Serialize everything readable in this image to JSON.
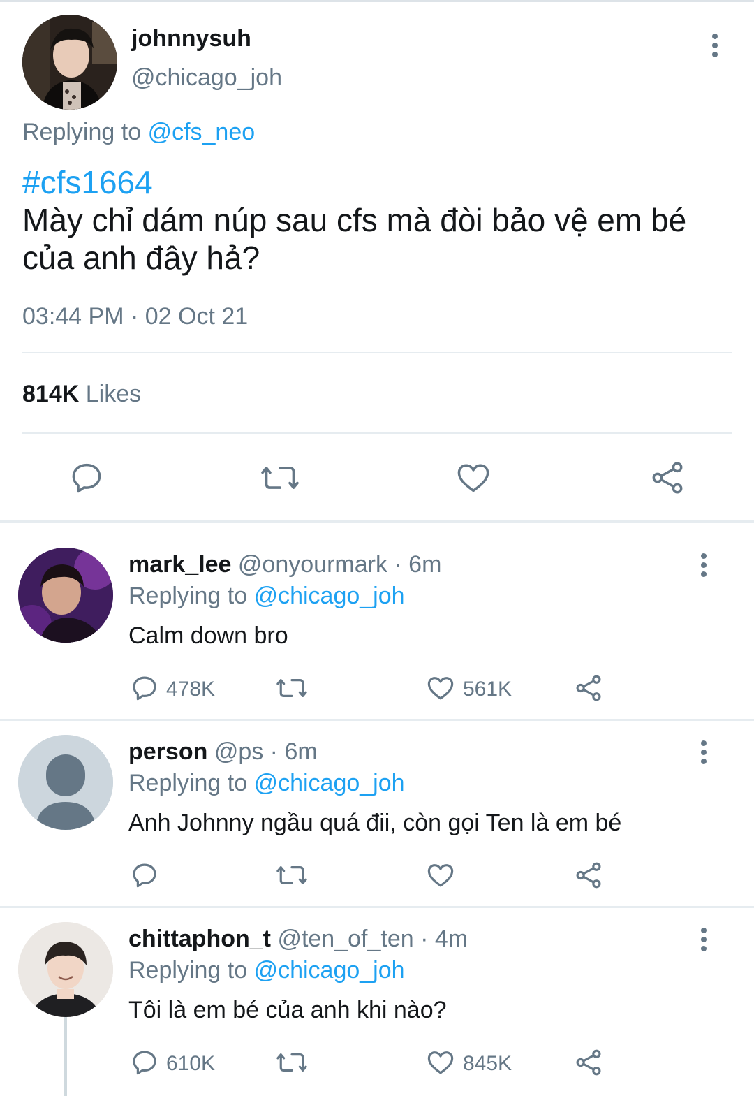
{
  "main_tweet": {
    "display_name": "johnnysuh",
    "handle": "@chicago_joh",
    "replying_prefix": "Replying to",
    "replying_to": "@cfs_neo",
    "hashtag": "#cfs1664",
    "text": "Mày chỉ dám núp sau cfs mà đòi bảo vệ em bé của anh đây hả?",
    "timestamp": "03:44 PM · 02 Oct 21",
    "likes_count": "814K",
    "likes_label": "Likes",
    "actions": [
      "reply-icon",
      "retweet-icon",
      "like-icon",
      "share-icon"
    ],
    "menu_icon": "kebab-icon"
  },
  "replies": [
    {
      "display_name": "mark_lee",
      "meta": "@onyourmark · 6m",
      "replying_prefix": "Replying to",
      "replying_to": "@chicago_joh",
      "text": "Calm down bro",
      "reply_count": "478K",
      "like_count": "561K",
      "avatar": "photo-avatar"
    },
    {
      "display_name": "person",
      "meta": "@ps · 6m",
      "replying_prefix": "Replying to",
      "replying_to": "@chicago_joh",
      "text": "Anh Johnny ngầu quá đii, còn gọi Ten là em bé",
      "reply_count": "",
      "like_count": "",
      "avatar": "default-person-avatar"
    },
    {
      "display_name": "chittaphon_t",
      "meta": "@ten_of_ten · 4m",
      "replying_prefix": "Replying to",
      "replying_to": "@chicago_joh",
      "text": "Tôi là em bé của anh khi nào?",
      "reply_count": "610K",
      "like_count": "845K",
      "avatar": "photo-avatar"
    }
  ],
  "colors": {
    "accent": "#1da1f2",
    "secondary_text": "#657786",
    "primary_text": "#14171a",
    "divider": "#e6ecf0"
  }
}
